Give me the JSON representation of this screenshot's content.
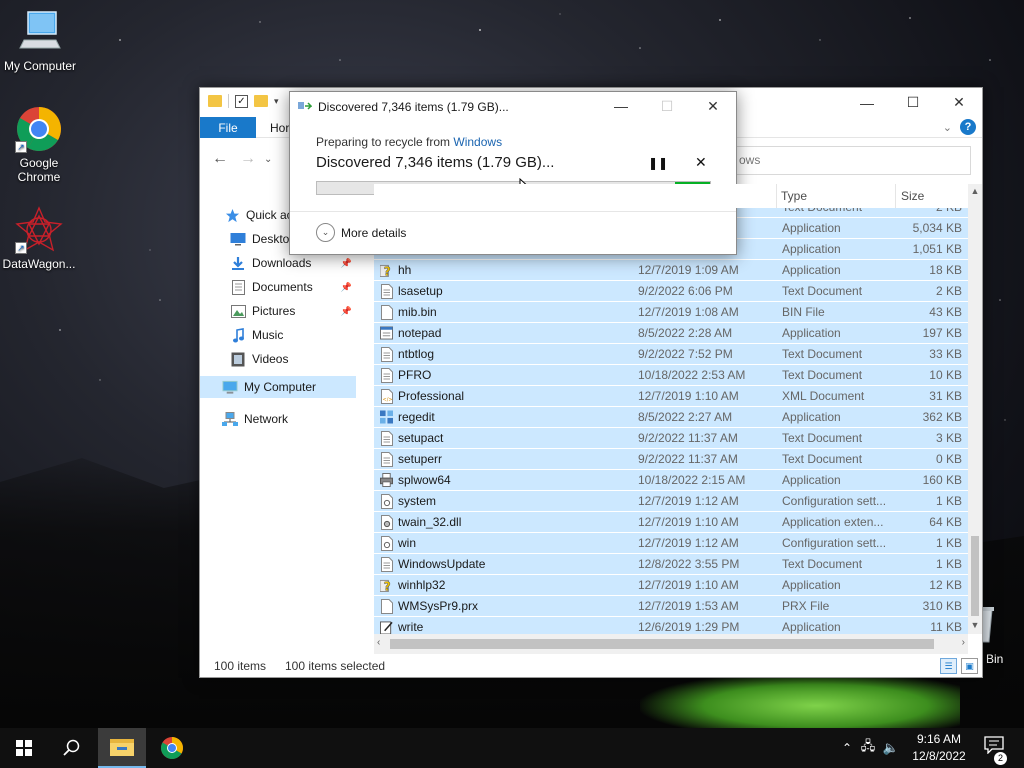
{
  "desktop": {
    "icons": [
      {
        "label": "My Computer"
      },
      {
        "label": "Google Chrome"
      },
      {
        "label": "DataWagon..."
      }
    ],
    "recycle_bin_label_partial": "Bin"
  },
  "explorer": {
    "ribbon": {
      "file_tab": "File",
      "home_tab": "Hor"
    },
    "search_partial": "ows",
    "sidebar": [
      {
        "label": "Quick ac",
        "icon": "star-icon"
      },
      {
        "label": "Deskto",
        "icon": "desktop-icon"
      },
      {
        "label": "Downloads",
        "icon": "download-icon",
        "pinned": true
      },
      {
        "label": "Documents",
        "icon": "documents-icon",
        "pinned": true
      },
      {
        "label": "Pictures",
        "icon": "pictures-icon",
        "pinned": true
      },
      {
        "label": "Music",
        "icon": "music-icon"
      },
      {
        "label": "Videos",
        "icon": "videos-icon"
      },
      {
        "label": "My Computer",
        "icon": "computer-icon",
        "selected": true
      },
      {
        "label": "Network",
        "icon": "network-icon"
      }
    ],
    "columns": {
      "type": "Type",
      "size": "Size"
    },
    "rows": [
      {
        "name": "",
        "date": "",
        "type": "Text Document",
        "size": "2 KB",
        "icon": "text-file-icon"
      },
      {
        "name": "",
        "date": "M",
        "type": "Application",
        "size": "5,034 KB",
        "icon": "app-icon"
      },
      {
        "name": "",
        "date": "M",
        "type": "Application",
        "size": "1,051 KB",
        "icon": "app-icon"
      },
      {
        "name": "hh",
        "date": "12/7/2019 1:09 AM",
        "type": "Application",
        "size": "18 KB",
        "icon": "help-file-icon"
      },
      {
        "name": "lsasetup",
        "date": "9/2/2022 6:06 PM",
        "type": "Text Document",
        "size": "2 KB",
        "icon": "text-file-icon"
      },
      {
        "name": "mib.bin",
        "date": "12/7/2019 1:08 AM",
        "type": "BIN File",
        "size": "43 KB",
        "icon": "blank-file-icon"
      },
      {
        "name": "notepad",
        "date": "8/5/2022 2:28 AM",
        "type": "Application",
        "size": "197 KB",
        "icon": "notepad-icon"
      },
      {
        "name": "ntbtlog",
        "date": "9/2/2022 7:52 PM",
        "type": "Text Document",
        "size": "33 KB",
        "icon": "text-file-icon"
      },
      {
        "name": "PFRO",
        "date": "10/18/2022 2:53 AM",
        "type": "Text Document",
        "size": "10 KB",
        "icon": "text-file-icon"
      },
      {
        "name": "Professional",
        "date": "12/7/2019 1:10 AM",
        "type": "XML Document",
        "size": "31 KB",
        "icon": "xml-file-icon"
      },
      {
        "name": "regedit",
        "date": "8/5/2022 2:27 AM",
        "type": "Application",
        "size": "362 KB",
        "icon": "regedit-icon"
      },
      {
        "name": "setupact",
        "date": "9/2/2022 11:37 AM",
        "type": "Text Document",
        "size": "3 KB",
        "icon": "text-file-icon"
      },
      {
        "name": "setuperr",
        "date": "9/2/2022 11:37 AM",
        "type": "Text Document",
        "size": "0 KB",
        "icon": "text-file-icon"
      },
      {
        "name": "splwow64",
        "date": "10/18/2022 2:15 AM",
        "type": "Application",
        "size": "160 KB",
        "icon": "printer-icon"
      },
      {
        "name": "system",
        "date": "12/7/2019 1:12 AM",
        "type": "Configuration sett...",
        "size": "1 KB",
        "icon": "config-file-icon"
      },
      {
        "name": "twain_32.dll",
        "date": "12/7/2019 1:10 AM",
        "type": "Application exten...",
        "size": "64 KB",
        "icon": "dll-file-icon"
      },
      {
        "name": "win",
        "date": "12/7/2019 1:12 AM",
        "type": "Configuration sett...",
        "size": "1 KB",
        "icon": "config-file-icon"
      },
      {
        "name": "WindowsUpdate",
        "date": "12/8/2022 3:55 PM",
        "type": "Text Document",
        "size": "1 KB",
        "icon": "text-file-icon"
      },
      {
        "name": "winhlp32",
        "date": "12/7/2019 1:10 AM",
        "type": "Application",
        "size": "12 KB",
        "icon": "help-file-icon"
      },
      {
        "name": "WMSysPr9.prx",
        "date": "12/7/2019 1:53 AM",
        "type": "PRX File",
        "size": "310 KB",
        "icon": "blank-file-icon"
      },
      {
        "name": "write",
        "date": "12/6/2019 1:29 PM",
        "type": "Application",
        "size": "11 KB",
        "icon": "write-icon"
      }
    ],
    "status": {
      "item_count": "100 items",
      "selected_count": "100 items selected"
    }
  },
  "dialog": {
    "title": "Discovered 7,346 items (1.79 GB)...",
    "prep_prefix": "Preparing to recycle from ",
    "prep_location": "Windows",
    "status": "Discovered 7,346 items (1.79 GB)...",
    "progress_fraction": 0.09,
    "more_details": "More details"
  },
  "taskbar": {
    "time": "9:16 AM",
    "date": "12/8/2022",
    "notification_count": "2"
  },
  "colors": {
    "accent": "#1979ca",
    "selection": "#cce8ff",
    "progress_fill": "#06b025",
    "link": "#1a64b0"
  }
}
